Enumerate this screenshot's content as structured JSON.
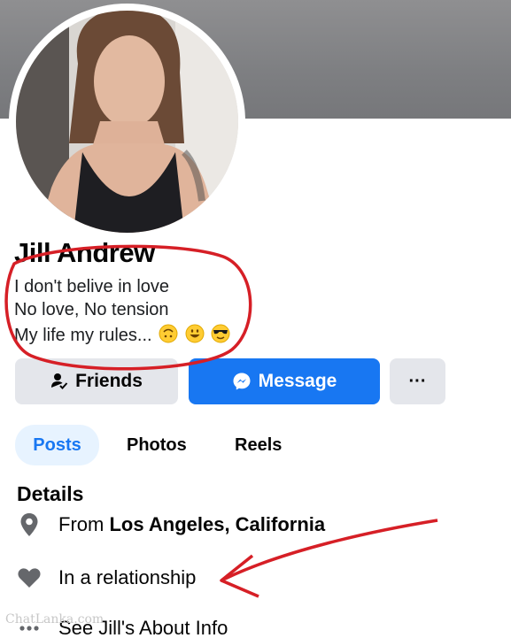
{
  "profile": {
    "name": "Jill Andrew",
    "bio": [
      "I don't belive in love",
      "No love, No tension",
      "My life my rules..."
    ],
    "bio_emojis": [
      "upside-down-face-emoji",
      "grinning-face-emoji",
      "sunglasses-face-emoji"
    ]
  },
  "actions": {
    "friends_label": "Friends",
    "message_label": "Message",
    "more_label": "···"
  },
  "tabs": [
    {
      "label": "Posts",
      "active": true
    },
    {
      "label": "Photos",
      "active": false
    },
    {
      "label": "Reels",
      "active": false
    }
  ],
  "details": {
    "title": "Details",
    "from_prefix": "From",
    "from_place": "Los Angeles, California",
    "relationship": "In a relationship",
    "about_link": "See Jill's About Info"
  },
  "watermark": "ChatLanka.com",
  "colors": {
    "brand_blue": "#1877f2",
    "button_gray": "#e4e6eb",
    "active_tab_bg": "#e7f3ff",
    "annotation_red": "#d61f26",
    "icon_gray": "#65676b"
  }
}
